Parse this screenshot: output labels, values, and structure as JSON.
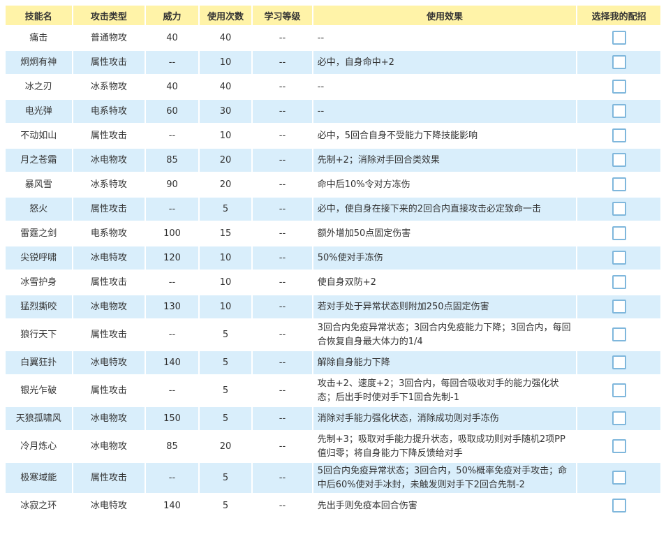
{
  "headers": [
    "技能名",
    "攻击类型",
    "威力",
    "使用次数",
    "学习等级",
    "使用效果",
    "选择我的配招"
  ],
  "rows": [
    {
      "name": "痛击",
      "type": "普通物攻",
      "power": "40",
      "uses": "40",
      "level": "--",
      "effect": "--"
    },
    {
      "name": "炯炯有神",
      "type": "属性攻击",
      "power": "--",
      "uses": "10",
      "level": "--",
      "effect": "必中，自身命中+2"
    },
    {
      "name": "冰之刃",
      "type": "冰系物攻",
      "power": "40",
      "uses": "40",
      "level": "--",
      "effect": "--"
    },
    {
      "name": "电光弹",
      "type": "电系特攻",
      "power": "60",
      "uses": "30",
      "level": "--",
      "effect": "--"
    },
    {
      "name": "不动如山",
      "type": "属性攻击",
      "power": "--",
      "uses": "10",
      "level": "--",
      "effect": "必中，5回合自身不受能力下降技能影响"
    },
    {
      "name": "月之苍霜",
      "type": "冰电物攻",
      "power": "85",
      "uses": "20",
      "level": "--",
      "effect": "先制+2；消除对手回合类效果"
    },
    {
      "name": "暴风雪",
      "type": "冰系特攻",
      "power": "90",
      "uses": "20",
      "level": "--",
      "effect": "命中后10%令对方冻伤"
    },
    {
      "name": "怒火",
      "type": "属性攻击",
      "power": "--",
      "uses": "5",
      "level": "--",
      "effect": "必中，使自身在接下来的2回合内直接攻击必定致命一击"
    },
    {
      "name": "雷霆之剑",
      "type": "电系物攻",
      "power": "100",
      "uses": "15",
      "level": "--",
      "effect": "额外增加50点固定伤害"
    },
    {
      "name": "尖锐呼啸",
      "type": "冰电特攻",
      "power": "120",
      "uses": "10",
      "level": "--",
      "effect": "50%使对手冻伤"
    },
    {
      "name": "冰雪护身",
      "type": "属性攻击",
      "power": "--",
      "uses": "10",
      "level": "--",
      "effect": "使自身双防+2"
    },
    {
      "name": "猛烈撕咬",
      "type": "冰电物攻",
      "power": "130",
      "uses": "10",
      "level": "--",
      "effect": "若对手处于异常状态则附加250点固定伤害"
    },
    {
      "name": "狼行天下",
      "type": "属性攻击",
      "power": "--",
      "uses": "5",
      "level": "--",
      "effect": "3回合内免疫异常状态；3回合内免疫能力下降；3回合内，每回合恢复自身最大体力的1/4"
    },
    {
      "name": "白翼狂扑",
      "type": "冰电特攻",
      "power": "140",
      "uses": "5",
      "level": "--",
      "effect": "解除自身能力下降"
    },
    {
      "name": "银光乍破",
      "type": "属性攻击",
      "power": "--",
      "uses": "5",
      "level": "--",
      "effect": "攻击+2、速度+2；3回合内，每回合吸收对手的能力强化状态；后出手时使对手下1回合先制-1"
    },
    {
      "name": "天狼孤啸风",
      "type": "冰电物攻",
      "power": "150",
      "uses": "5",
      "level": "--",
      "effect": "消除对手能力强化状态，消除成功则对手冻伤"
    },
    {
      "name": "冷月炼心",
      "type": "冰电物攻",
      "power": "85",
      "uses": "20",
      "level": "--",
      "effect": "先制+3；吸取对手能力提升状态，吸取成功则对手随机2项PP值归零；将自身能力下降反馈给对手"
    },
    {
      "name": "极寒域能",
      "type": "属性攻击",
      "power": "--",
      "uses": "5",
      "level": "--",
      "effect": "5回合内免疫异常状态；3回合内，50%概率免疫对手攻击；命中后60%使对手冰封，未触发则对手下2回合先制-2"
    },
    {
      "name": "冰寂之环",
      "type": "冰电特攻",
      "power": "140",
      "uses": "5",
      "level": "--",
      "effect": "先出手则免疫本回合伤害"
    }
  ]
}
